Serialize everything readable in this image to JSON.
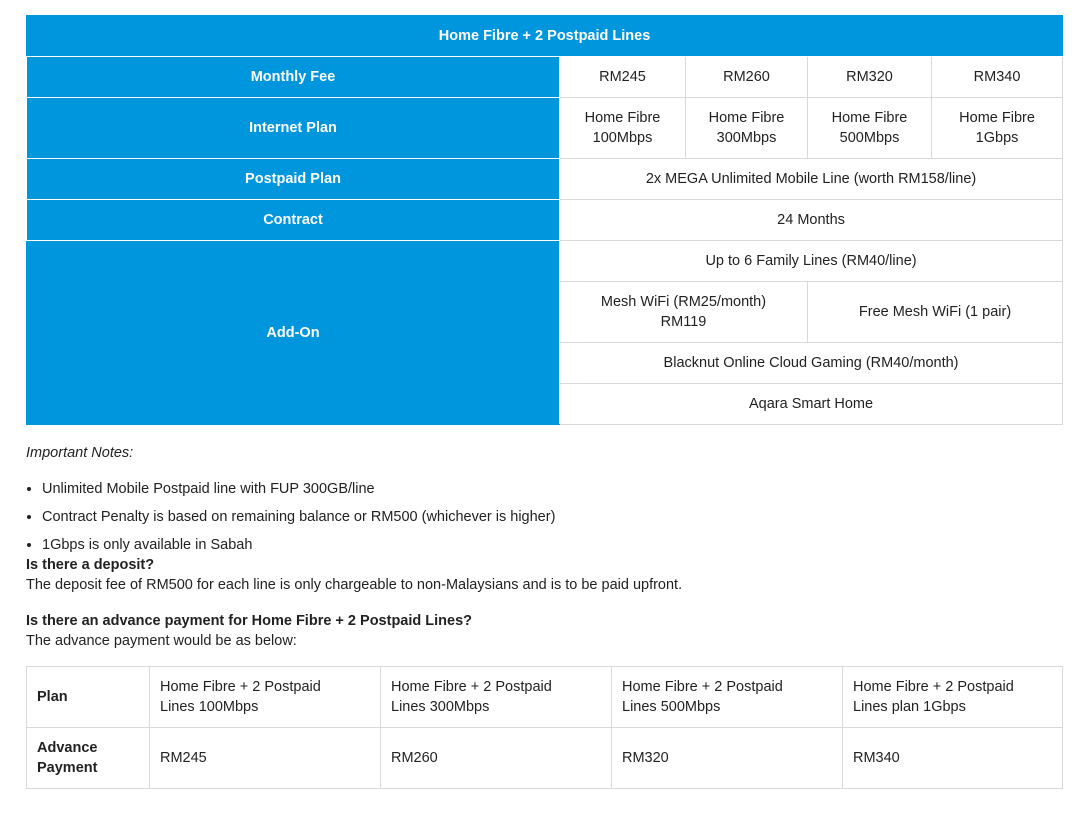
{
  "main_table": {
    "title": "Home Fibre + 2 Postpaid Lines",
    "monthly_fee_label": "Monthly Fee",
    "monthly_fees": [
      "RM245",
      "RM260",
      "RM320",
      "RM340"
    ],
    "internet_plan_label": "Internet Plan",
    "internet_plans": [
      {
        "line1": "Home Fibre",
        "line2": "100Mbps"
      },
      {
        "line1": "Home Fibre",
        "line2": "300Mbps"
      },
      {
        "line1": "Home Fibre",
        "line2": "500Mbps"
      },
      {
        "line1": "Home Fibre",
        "line2": "1Gbps"
      }
    ],
    "postpaid_plan_label": "Postpaid Plan",
    "postpaid_plan": "2x MEGA Unlimited Mobile Line (worth RM158/line)",
    "contract_label": "Contract",
    "contract": "24 Months",
    "addon_label": "Add-On",
    "addons": {
      "family_lines": "Up to 6 Family Lines (RM40/line)",
      "mesh_paid_line1": "Mesh WiFi (RM25/month)",
      "mesh_paid_line2": "RM119",
      "mesh_free": "Free Mesh WiFi (1 pair)",
      "gaming": "Blacknut Online Cloud Gaming (RM40/month)",
      "smart_home": "Aqara Smart Home"
    }
  },
  "notes": {
    "title": "Important Notes:",
    "items": [
      "Unlimited Mobile Postpaid line with FUP 300GB/line",
      "Contract Penalty is based on remaining balance or RM500 (whichever is higher)",
      "1Gbps is only available in Sabah"
    ]
  },
  "faq": [
    {
      "question": "Is there a deposit?",
      "answer": "The deposit fee of RM500 for each line is only chargeable to non-Malaysians and is to be paid upfront."
    },
    {
      "question": "Is there an advance payment for Home Fibre + 2 Postpaid Lines?",
      "answer": "The advance payment would be as below:"
    }
  ],
  "advance_table": {
    "plan_label": "Plan",
    "plans": [
      {
        "line1": "Home Fibre + 2 Postpaid",
        "line2": "Lines 100Mbps"
      },
      {
        "line1": "Home Fibre + 2 Postpaid",
        "line2": "Lines 300Mbps"
      },
      {
        "line1": "Home Fibre + 2 Postpaid",
        "line2": "Lines 500Mbps"
      },
      {
        "line1": "Home Fibre + 2 Postpaid",
        "line2": "Lines plan 1Gbps"
      }
    ],
    "payment_label_line1": "Advance",
    "payment_label_line2": "Payment",
    "payments": [
      "RM245",
      "RM260",
      "RM320",
      "RM340"
    ]
  },
  "colors": {
    "header_blue": "#0096dd",
    "border": "#d9d9d9"
  }
}
